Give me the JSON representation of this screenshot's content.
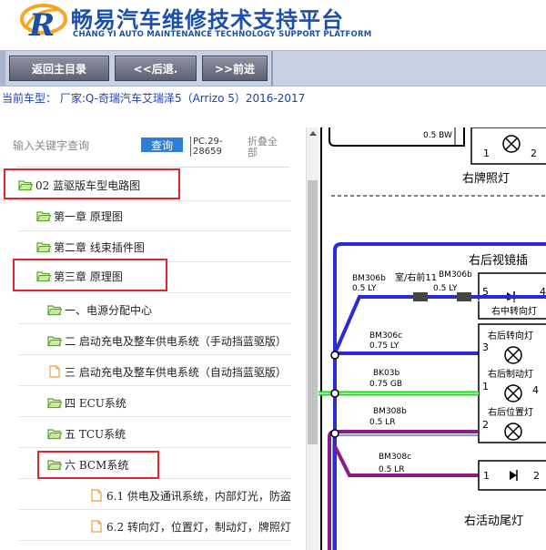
{
  "header": {
    "title_cn": "畅易汽车维修技术支持平台",
    "title_en": "CHANG YI AUTO MAINTENANCE TECHNOLOGY SUPPORT PLATFORM",
    "logo_letter": "R"
  },
  "toolbar": {
    "home_label": "返回主目录",
    "back_label": "<<后退.",
    "forward_label": ">>前进"
  },
  "vehicle": {
    "text": "当前车型：  厂家:Q-奇瑞汽车艾瑞泽5（Arrizo 5）2016-2017"
  },
  "search": {
    "placeholder": "输入关键字查询",
    "query_label": "查询",
    "code": "PC.29-28659",
    "fold_label": "折叠全部"
  },
  "tree": {
    "items": [
      {
        "label": "02 蓝驱版车型电路图",
        "icon": "folder-open-icon"
      },
      {
        "label": "第一章 原理图",
        "icon": "folder-open-icon"
      },
      {
        "label": "第二章 线束插件图",
        "icon": "folder-open-icon"
      },
      {
        "label": "第三章 原理图",
        "icon": "folder-open-icon"
      },
      {
        "label": "一、电源分配中心",
        "icon": "folder-open-icon"
      },
      {
        "label": "二 启动充电及整车供电系统（手动挡蓝驱版）",
        "icon": "folder-open-icon"
      },
      {
        "label": "三 启动充电及整车供电系统（自动挡蓝驱版）",
        "icon": "document-icon"
      },
      {
        "label": "四 ECU系统",
        "icon": "folder-open-icon"
      },
      {
        "label": "五 TCU系统",
        "icon": "folder-open-icon"
      },
      {
        "label": "六 BCM系统",
        "icon": "folder-open-icon"
      },
      {
        "label": "6.1 供电及通讯系统，内部灯光，防盗",
        "icon": "document-icon"
      },
      {
        "label": "6.2 转向灯，位置灯，制动灯，牌照灯",
        "icon": "document-icon"
      }
    ]
  },
  "diagram": {
    "labels": {
      "wire_top": "0.5 BW",
      "plate_lamp": "右牌照灯",
      "mirror_title": "右后视镜插",
      "bm306b_left": "BM306b",
      "bm306b_left_spec": "0.5 LY",
      "room_label": "室/右前11",
      "bm306b_right": "BM306b",
      "bm306b_right_spec": "0.5 LY",
      "center_turn": "右中转向灯",
      "bm306c": "BM306c",
      "bm306c_spec": "0.75 LY",
      "rear_turn": "右后转向灯",
      "bk03b": "BK03b",
      "bk03b_spec": "0.75 GB",
      "rear_brake": "右后制动灯",
      "bm308b": "BM308b",
      "bm308b_spec": "0.5 LR",
      "rear_position": "右后位置灯",
      "bm308c": "BM308c",
      "bm308c_spec": "0.5 LR",
      "tail_lamp": "右活动尾灯",
      "pin_1": "1",
      "pin_2": "2",
      "pin_3": "3",
      "pin_4": "4",
      "pin_5": "5"
    },
    "colors": {
      "blue_wire": "#2a2ad8",
      "green_wire": "#22d822",
      "purple_wire": "#8a1a8a",
      "box_border": "#000000"
    }
  },
  "colors": {
    "brand_blue": "#1b4fa8",
    "highlight_red": "#e0242c",
    "query_button": "#2c7fd6",
    "toolbar_bg": "#c8d1e4"
  }
}
